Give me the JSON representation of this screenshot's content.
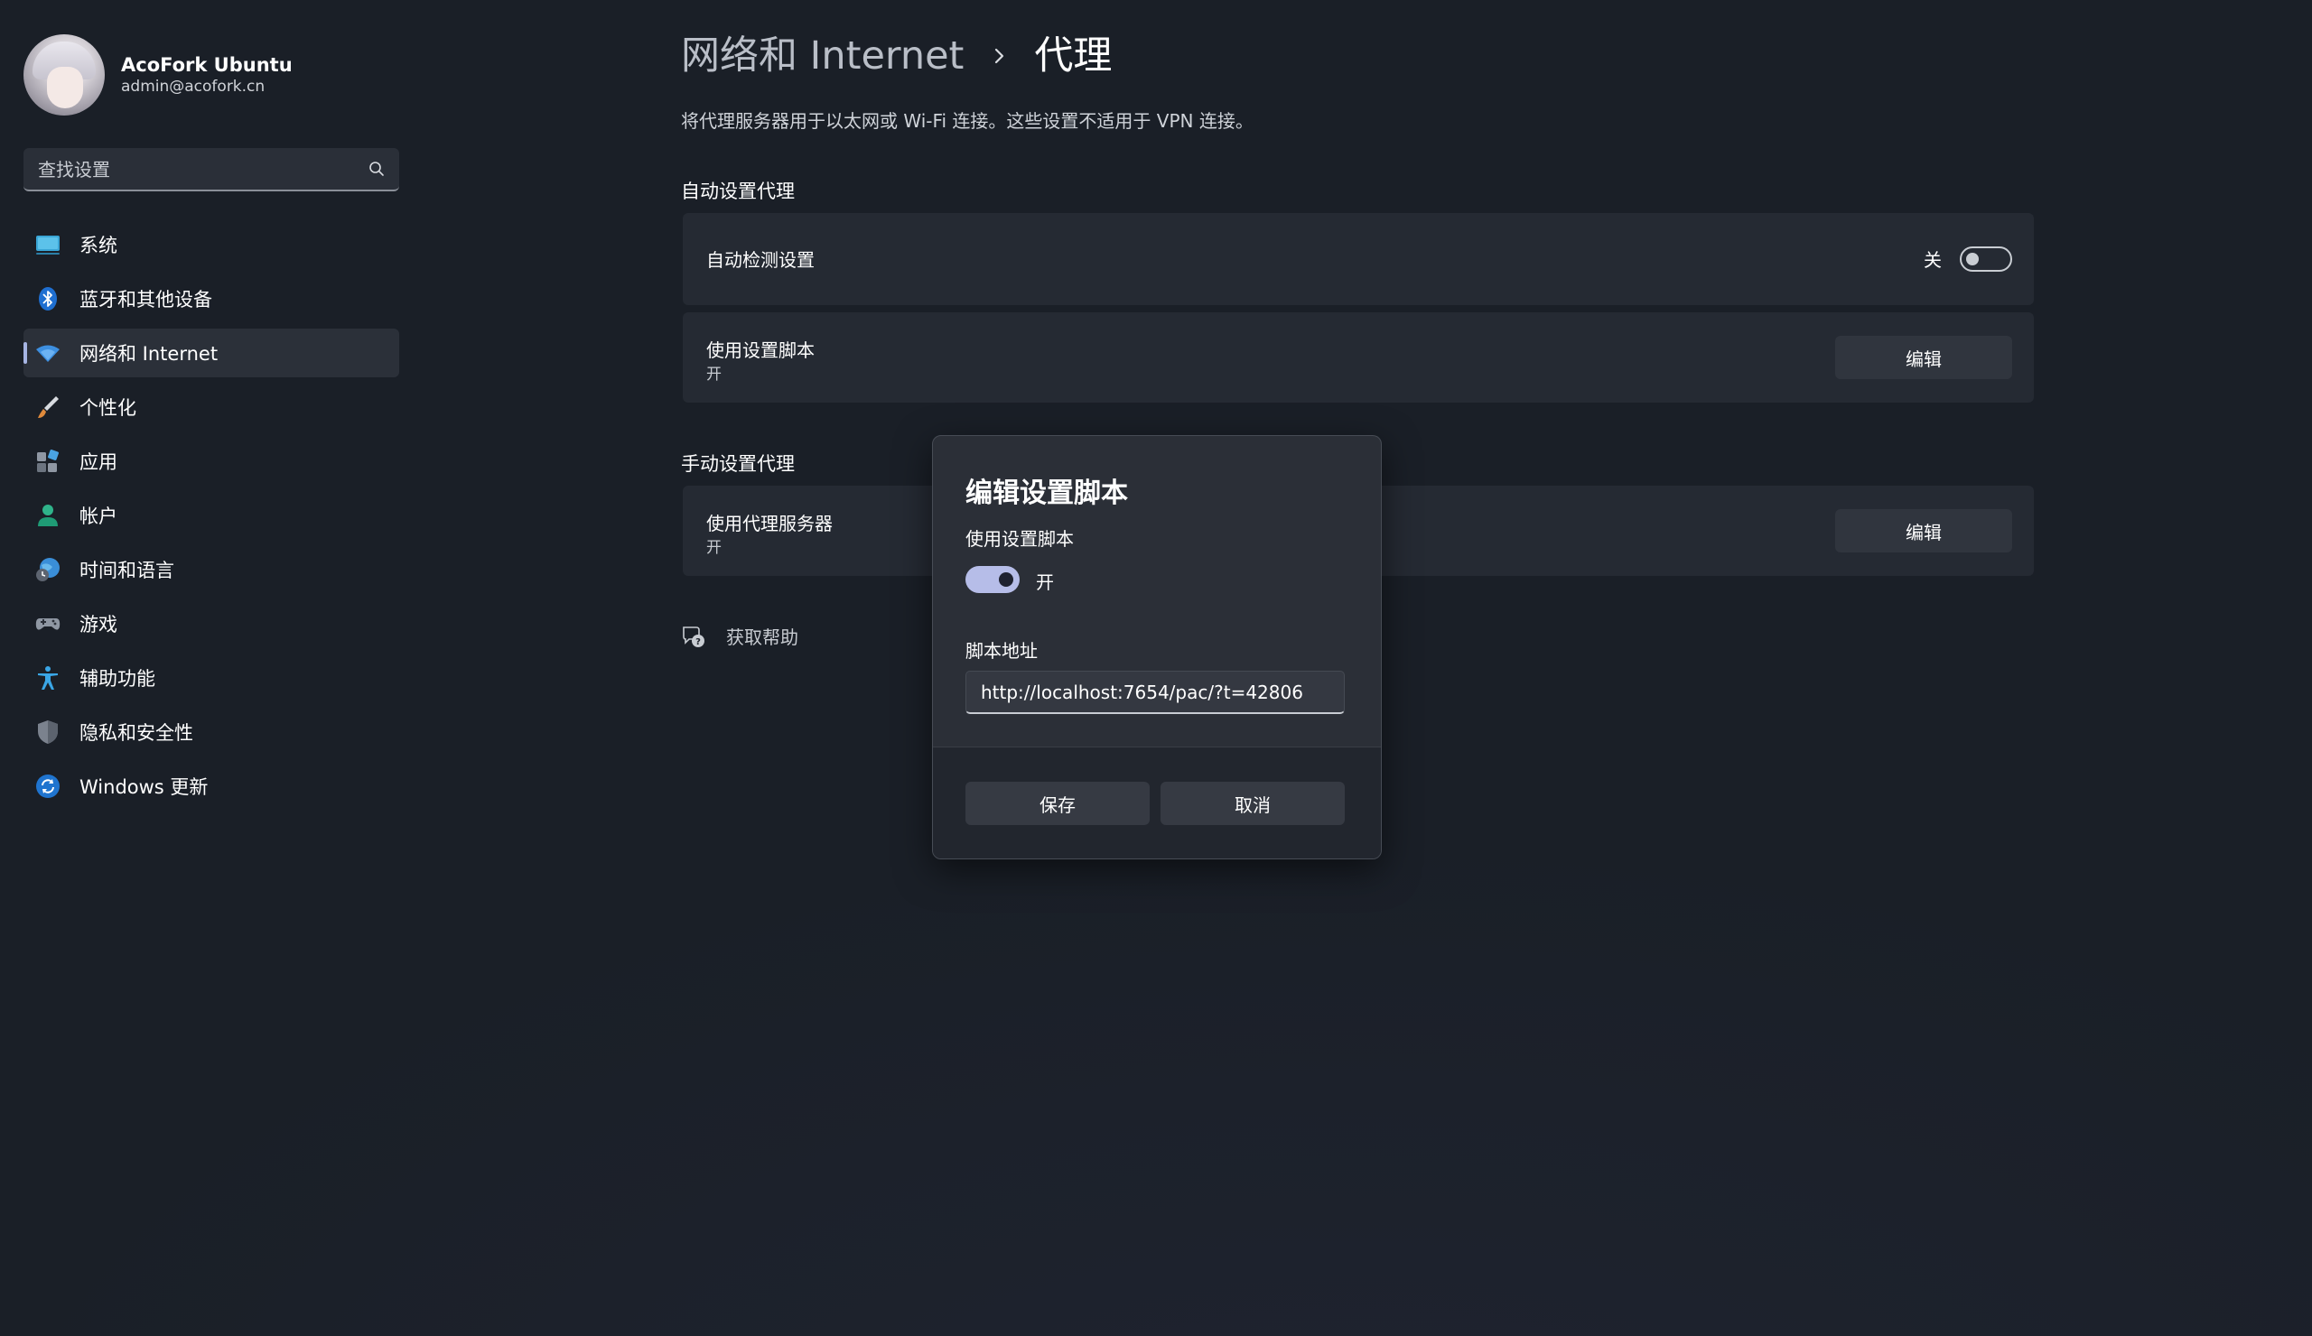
{
  "profile": {
    "name": "AcoFork Ubuntu",
    "email": "admin@acofork.cn"
  },
  "search": {
    "placeholder": "查找设置",
    "icon": "search-icon"
  },
  "sidebar": {
    "items": [
      {
        "label": "系统",
        "icon": "monitor-icon"
      },
      {
        "label": "蓝牙和其他设备",
        "icon": "bluetooth-icon"
      },
      {
        "label": "网络和 Internet",
        "icon": "wifi-icon",
        "active": true
      },
      {
        "label": "个性化",
        "icon": "brush-icon"
      },
      {
        "label": "应用",
        "icon": "apps-icon"
      },
      {
        "label": "帐户",
        "icon": "person-icon"
      },
      {
        "label": "时间和语言",
        "icon": "globe-clock-icon"
      },
      {
        "label": "游戏",
        "icon": "gamepad-icon"
      },
      {
        "label": "辅助功能",
        "icon": "accessibility-icon"
      },
      {
        "label": "隐私和安全性",
        "icon": "shield-icon"
      },
      {
        "label": "Windows 更新",
        "icon": "refresh-icon"
      }
    ]
  },
  "header": {
    "parent": "网络和 Internet",
    "separator_icon": "chevron-right-icon",
    "current": "代理",
    "description": "将代理服务器用于以太网或 Wi-Fi 连接。这些设置不适用于 VPN 连接。"
  },
  "auto_proxy": {
    "section_title": "自动设置代理",
    "detect": {
      "title": "自动检测设置",
      "state_label": "关",
      "enabled": false
    },
    "script": {
      "title": "使用设置脚本",
      "subtitle": "开",
      "button_label": "编辑"
    }
  },
  "manual_proxy": {
    "section_title": "手动设置代理",
    "server": {
      "title": "使用代理服务器",
      "subtitle": "开",
      "button_label": "编辑"
    }
  },
  "help": {
    "label": "获取帮助",
    "icon": "help-chat-icon"
  },
  "dialog": {
    "title": "编辑设置脚本",
    "toggle_label": "使用设置脚本",
    "toggle_state": "开",
    "toggle_enabled": true,
    "field_label": "脚本地址",
    "field_value": "http://localhost:7654/pac/?t=42806",
    "save_label": "保存",
    "cancel_label": "取消"
  },
  "colors": {
    "background": "#1a1f27",
    "card": "#252a33",
    "accent": "#b6bde8",
    "active_indicator": "#a6b4e3"
  }
}
